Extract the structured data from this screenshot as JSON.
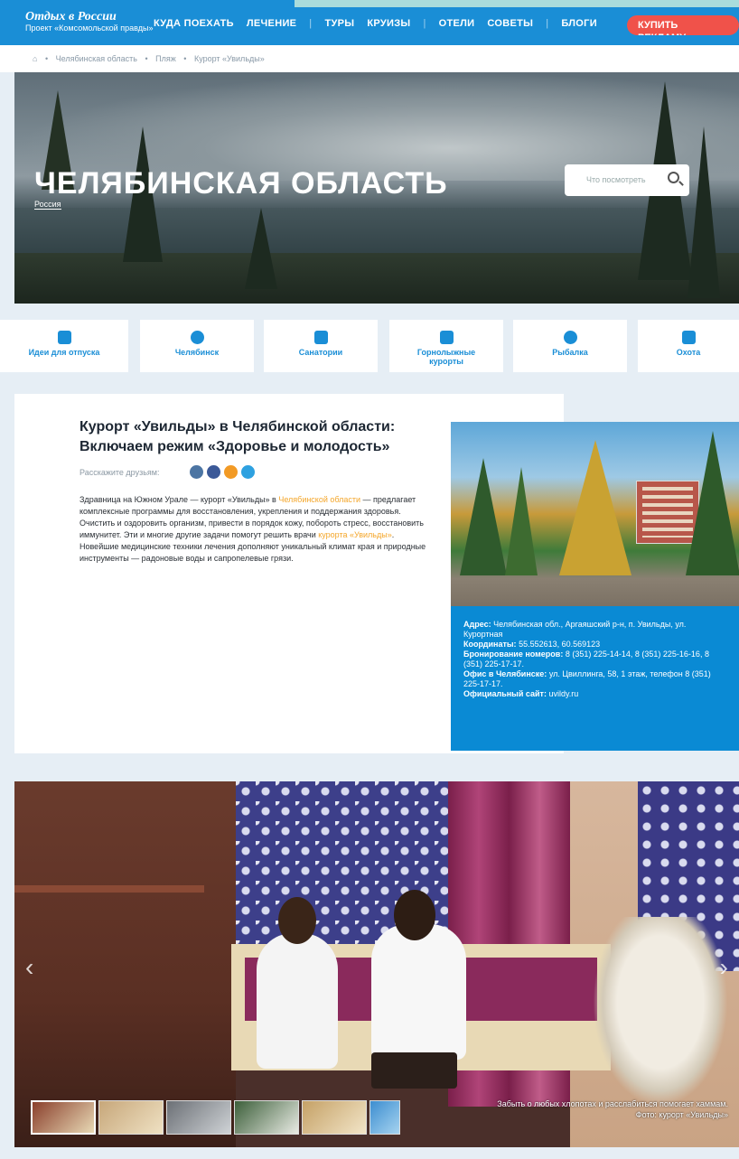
{
  "header": {
    "logo_title": "Отдых в России",
    "logo_subtitle": "Проект «Комсомольской правды»",
    "nav": [
      "КУДА ПОЕХАТЬ",
      "ЛЕЧЕНИЕ",
      "ТУРЫ",
      "КРУИЗЫ",
      "ОТЕЛИ",
      "СОВЕТЫ",
      "БЛОГИ"
    ],
    "cta": "КУПИТЬ РЕКЛАМУ"
  },
  "breadcrumb": [
    "Челябинская область",
    "Пляж",
    "Курорт «Увильды»"
  ],
  "hero": {
    "title": "ЧЕЛЯБИНСКАЯ ОБЛАСТЬ",
    "subtitle": "Россия",
    "search_placeholder": "Что посмотреть"
  },
  "categories": [
    {
      "label": "Идеи для отпуска",
      "icon": "camera-icon"
    },
    {
      "label": "Челябинск",
      "icon": "map-pin-icon"
    },
    {
      "label": "Санатории",
      "icon": "building-icon"
    },
    {
      "label": "Горнолыжные курорты",
      "icon": "mountain-icon"
    },
    {
      "label": "Рыбалка",
      "icon": "fish-icon"
    },
    {
      "label": "Охота",
      "icon": "bird-icon"
    }
  ],
  "article": {
    "title": "Курорт «Увильды» в Челябинской области: Включаем режим «Здоровье и молодость»",
    "share_label": "Расскажите друзьям:",
    "share_icons": [
      "vk-icon",
      "facebook-icon",
      "odnoklassniki-icon",
      "twitter-icon"
    ],
    "body_1": "Здравница на Южном Урале — курорт «Увильды» в ",
    "link_1": "Челябинской области",
    "body_2": " — предлагает комплексные программы для восстановления, укрепления и поддержания здоровья. Очистить и оздоровить организм, привести в порядок кожу, побороть стресс, восстановить иммунитет. Эти и многие другие задачи помогут решить врачи ",
    "link_2": "курорта «Увильды»",
    "body_3": ". Новейшие медицинские техники лечения дополняют уникальный климат края и природные инструменты — радоновые воды и сапропелевые грязи."
  },
  "info": {
    "address_label": "Адрес:",
    "address_value": "Челябинская обл., Аргаяшский р-н, п. Увильды, ул. Курортная",
    "coords_label": "Координаты:",
    "coords_value": "55.552613, 60.569123",
    "booking_label": "Бронирование номеров:",
    "booking_value": "8 (351) 225-14-14, 8 (351) 225-16-16, 8 (351) 225-17-17.",
    "office_label": "Офис в Челябинске:",
    "office_value": "ул. Цвиллинга, 58, 1 этаж, телефон 8 (351) 225-17-17.",
    "site_label": "Официальный сайт:",
    "site_value": "uvildy.ru"
  },
  "gallery": {
    "caption_line1": "Забыть о любых хлопотах и расслабиться помогает хаммам.",
    "caption_line2": "Фото: курорт «Увильды»"
  },
  "colors": {
    "brand_blue": "#1a8ed6",
    "cta_red": "#f0524a",
    "link_orange": "#f4a62a"
  }
}
